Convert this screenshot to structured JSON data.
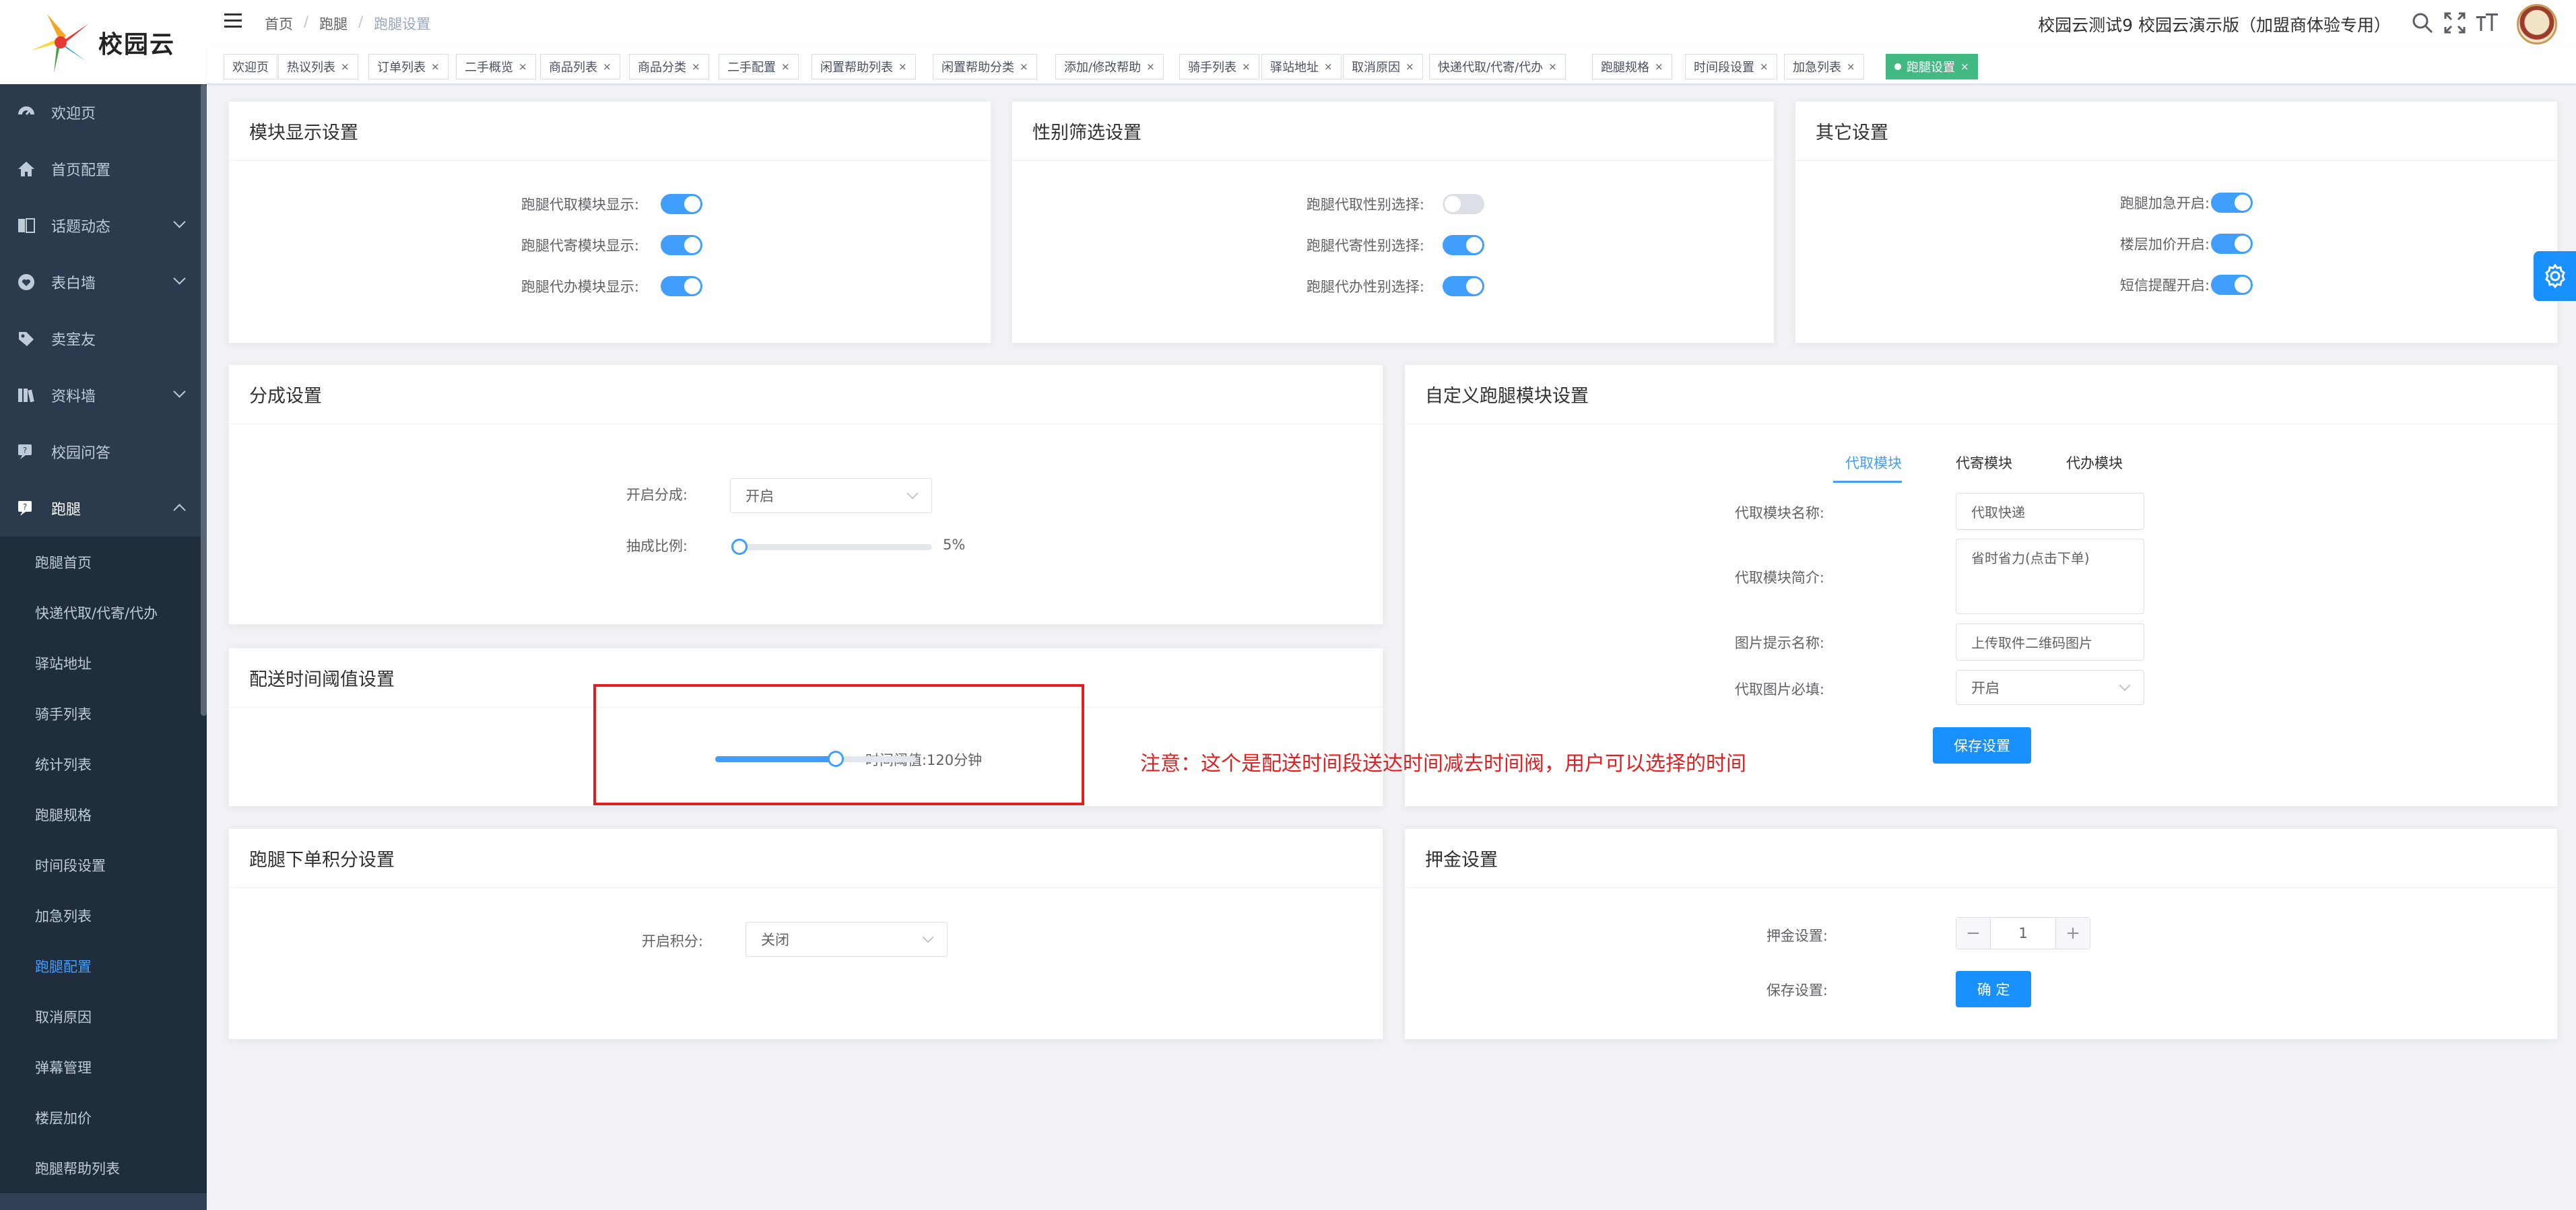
{
  "logo": {
    "text": "校园云"
  },
  "sidebar": {
    "items": [
      {
        "label": "欢迎页",
        "icon": "dashboard-icon",
        "expandable": false
      },
      {
        "label": "首页配置",
        "icon": "home-icon",
        "expandable": false
      },
      {
        "label": "话题动态",
        "icon": "book-icon",
        "expandable": true
      },
      {
        "label": "表白墙",
        "icon": "heart-icon",
        "expandable": true
      },
      {
        "label": "卖室友",
        "icon": "tag-icon",
        "expandable": false
      },
      {
        "label": "资料墙",
        "icon": "library-icon",
        "expandable": true
      },
      {
        "label": "校园问答",
        "icon": "qa-icon",
        "expandable": false
      }
    ],
    "open_group": {
      "label": "跑腿",
      "icon": "errand-icon",
      "children": [
        {
          "label": "跑腿首页",
          "active": false
        },
        {
          "label": "快递代取/代寄/代办",
          "active": false
        },
        {
          "label": "驿站地址",
          "active": false
        },
        {
          "label": "骑手列表",
          "active": false
        },
        {
          "label": "统计列表",
          "active": false
        },
        {
          "label": "跑腿规格",
          "active": false
        },
        {
          "label": "时间段设置",
          "active": false
        },
        {
          "label": "加急列表",
          "active": false
        },
        {
          "label": "跑腿配置",
          "active": true
        },
        {
          "label": "取消原因",
          "active": false
        },
        {
          "label": "弹幕管理",
          "active": false
        },
        {
          "label": "楼层加价",
          "active": false
        },
        {
          "label": "跑腿帮助列表",
          "active": false
        }
      ]
    }
  },
  "header": {
    "breadcrumb": [
      "首页",
      "跑腿",
      "跑腿设置"
    ],
    "site_title": "校园云测试9 校园云演示版（加盟商体验专用）",
    "icons": [
      "search-icon",
      "fullscreen-icon",
      "font-size-icon"
    ]
  },
  "tags": [
    {
      "label": "欢迎页",
      "closable": false,
      "active": false
    },
    {
      "label": "热议列表",
      "closable": true,
      "active": false
    },
    {
      "label": "订单列表",
      "closable": true,
      "active": false
    },
    {
      "label": "二手概览",
      "closable": true,
      "active": false
    },
    {
      "label": "商品列表",
      "closable": true,
      "active": false
    },
    {
      "label": "商品分类",
      "closable": true,
      "active": false
    },
    {
      "label": "二手配置",
      "closable": true,
      "active": false
    },
    {
      "label": "闲置帮助列表",
      "closable": true,
      "active": false
    },
    {
      "label": "闲置帮助分类",
      "closable": true,
      "active": false
    },
    {
      "label": "添加/修改帮助",
      "closable": true,
      "active": false
    },
    {
      "label": "骑手列表",
      "closable": true,
      "active": false
    },
    {
      "label": "驿站地址",
      "closable": true,
      "active": false
    },
    {
      "label": "取消原因",
      "closable": true,
      "active": false
    },
    {
      "label": "快递代取/代寄/代办",
      "closable": true,
      "active": false
    },
    {
      "label": "跑腿规格",
      "closable": true,
      "active": false
    },
    {
      "label": "时间段设置",
      "closable": true,
      "active": false
    },
    {
      "label": "加急列表",
      "closable": true,
      "active": false
    },
    {
      "label": "跑腿设置",
      "closable": true,
      "active": true
    }
  ],
  "module_display": {
    "title": "模块显示设置",
    "rows": [
      {
        "label": "跑腿代取模块显示:",
        "on": true
      },
      {
        "label": "跑腿代寄模块显示:",
        "on": true
      },
      {
        "label": "跑腿代办模块显示:",
        "on": true
      }
    ]
  },
  "gender_filter": {
    "title": "性别筛选设置",
    "rows": [
      {
        "label": "跑腿代取性别选择:",
        "on": false
      },
      {
        "label": "跑腿代寄性别选择:",
        "on": true
      },
      {
        "label": "跑腿代办性别选择:",
        "on": true
      }
    ]
  },
  "other_settings": {
    "title": "其它设置",
    "rows": [
      {
        "label": "跑腿加急开启:",
        "on": true
      },
      {
        "label": "楼层加价开启:",
        "on": true
      },
      {
        "label": "短信提醒开启:",
        "on": true
      }
    ]
  },
  "commission": {
    "title": "分成设置",
    "enable_label": "开启分成:",
    "enable_value": "开启",
    "ratio_label": "抽成比例:",
    "ratio_value": "5%",
    "ratio_fraction": 0.0
  },
  "custom_module": {
    "title": "自定义跑腿模块设置",
    "tabs": [
      {
        "label": "代取模块",
        "active": true
      },
      {
        "label": "代寄模块",
        "active": false
      },
      {
        "label": "代办模块",
        "active": false
      }
    ],
    "name_label": "代取模块名称:",
    "name_value": "代取快递",
    "intro_label": "代取模块简介:",
    "intro_value": "省时省力(点击下单)",
    "image_hint_label": "图片提示名称:",
    "image_hint_value": "上传取件二维码图片",
    "image_required_label": "代取图片必填:",
    "image_required_value": "开启",
    "save_label": "保存设置"
  },
  "delivery_threshold": {
    "title": "配送时间阈值设置",
    "label": "时间阈值:",
    "value_text": "120分钟",
    "fraction": 0.6
  },
  "annotation": {
    "note": "注意：这个是配送时间段送达时间减去时间阀，用户可以选择的时间",
    "color": "#e02020"
  },
  "points": {
    "title": "跑腿下单积分设置",
    "label": "开启积分:",
    "value": "关闭"
  },
  "deposit": {
    "title": "押金设置",
    "label": "押金设置:",
    "value": "1",
    "minus": "−",
    "plus": "+",
    "save_label": "保存设置:",
    "confirm_label": "确 定"
  },
  "colors": {
    "primary": "#409eff",
    "button": "#1890ff",
    "sidebar_bg": "#304156",
    "active_tag": "#42b983",
    "annotation": "#e02020"
  }
}
